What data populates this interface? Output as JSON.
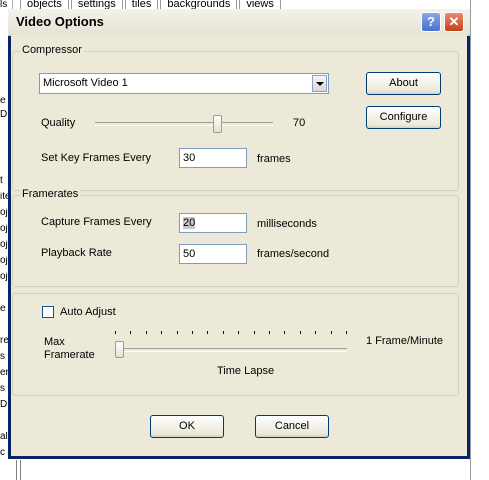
{
  "background": {
    "tabs": [
      "objects",
      "settings",
      "tiles",
      "backgrounds",
      "views"
    ],
    "left_fragments": [
      "ls",
      "e",
      "D",
      "t",
      "ite",
      "oj",
      "oj",
      "oj",
      "oj",
      "oj",
      "e",
      "re",
      "s",
      "er",
      "s",
      "D",
      "al",
      "c"
    ]
  },
  "dialog": {
    "title": "Video Options",
    "help_label": "?",
    "close_label": "✕",
    "compressor": {
      "group_label": "Compressor",
      "selected": "Microsoft Video 1",
      "about_label": "About",
      "configure_label": "Configure",
      "quality_label": "Quality",
      "quality_value": "70",
      "quality_fraction": 0.7,
      "keyframes_label": "Set Key Frames Every",
      "keyframes_value": "30",
      "keyframes_unit": "frames"
    },
    "framerates": {
      "group_label": "Framerates",
      "capture_label": "Capture Frames Every",
      "capture_value": "20",
      "capture_unit": "milliseconds",
      "playback_label": "Playback Rate",
      "playback_value": "50",
      "playback_unit": "frames/second"
    },
    "timelapse": {
      "auto_adjust_label": "Auto Adjust",
      "auto_adjust_checked": false,
      "max_framerate_label_line1": "Max",
      "max_framerate_label_line2": "Framerate",
      "max_value_label": "1 Frame/Minute",
      "caption": "Time Lapse",
      "tick_count": 16,
      "slider_fraction": 0.0
    },
    "ok_label": "OK",
    "cancel_label": "Cancel"
  }
}
